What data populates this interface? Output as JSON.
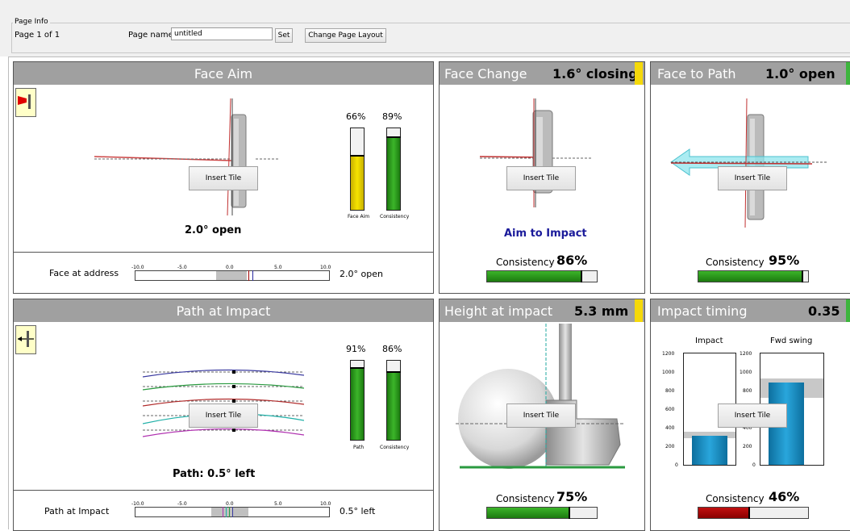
{
  "page_info": {
    "legend": "Page Info",
    "page_count": "Page 1 of 1",
    "name_label": "Page name:",
    "name_value": "untitled",
    "set_label": "Set",
    "change_layout_label": "Change Page Layout"
  },
  "insert_tile_label": "Insert Tile",
  "face_aim": {
    "title": "Face Aim",
    "bar1_pct": "66%",
    "bar1_value": 0.66,
    "bar1_label": "Face Aim",
    "bar2_pct": "89%",
    "bar2_value": 0.89,
    "bar2_label": "Consistency",
    "result": "2.0° open",
    "address_label": "Face at address",
    "address_value": "2.0° open",
    "scale_ticks": [
      "-10.0",
      "-5.0",
      "0.0",
      "5.0",
      "10.0"
    ]
  },
  "face_change": {
    "title": "Face Change",
    "value": "1.6° closing",
    "flag_color": "#f5d90a",
    "subtitle": "Aim to Impact",
    "consistency_label": "Consistency",
    "consistency_pct": "86%",
    "consistency_value": 0.86
  },
  "face_to_path": {
    "title": "Face to Path",
    "value": "1.0° open",
    "flag_color": "#3db53d",
    "consistency_label": "Consistency",
    "consistency_pct": "95%",
    "consistency_value": 0.95
  },
  "path_at_impact": {
    "title": "Path at Impact",
    "bar1_pct": "91%",
    "bar1_value": 0.91,
    "bar1_label": "Path",
    "bar2_pct": "86%",
    "bar2_value": 0.86,
    "bar2_label": "Consistency",
    "result": "Path: 0.5° left",
    "impact_label": "Path at Impact",
    "impact_value": "0.5° left",
    "scale_ticks": [
      "-10.0",
      "-5.0",
      "0.0",
      "5.0",
      "10.0"
    ]
  },
  "height_at_impact": {
    "title": "Height at impact",
    "value": "5.3 mm",
    "flag_color": "#f5d90a",
    "consistency_label": "Consistency",
    "consistency_pct": "75%",
    "consistency_value": 0.75
  },
  "impact_timing": {
    "title": "Impact timing",
    "value": "0.35",
    "flag_color": "#3db53d",
    "chart1_label": "Impact",
    "chart2_label": "Fwd swing",
    "axis_ticks": [
      "1200",
      "1000",
      "800",
      "600",
      "400",
      "200",
      "0"
    ],
    "consistency_label": "Consistency",
    "consistency_pct": "46%",
    "consistency_value": 0.46
  },
  "colors": {
    "header_gray": "#a0a0a0",
    "consistency_green": "#2f9a1c",
    "face_aim_yellow": "#e0c800",
    "timing_blue": "#1a8fc6",
    "low_red": "#b00000",
    "navy_text": "#1a1a9a"
  }
}
